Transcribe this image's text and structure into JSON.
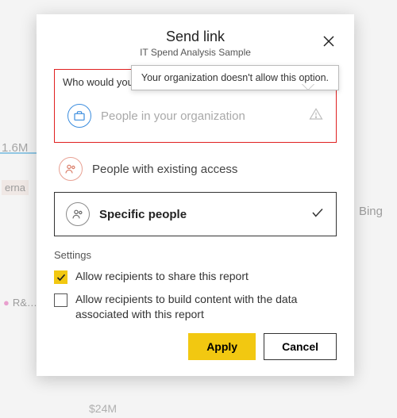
{
  "background": {
    "value": "1.6M",
    "label_erna": "erna",
    "bing": "Bing",
    "rnd": "R&…",
    "bottom": "$24M"
  },
  "dialog": {
    "title": "Send link",
    "subtitle": "IT Spend Analysis Sample",
    "prompt": "Who would you like the lin…",
    "tooltip": "Your organization doesn't allow this option.",
    "options": {
      "org": "People in your organization",
      "existing": "People with existing access",
      "specific": "Specific people"
    },
    "settings": {
      "heading": "Settings",
      "allow_share": "Allow recipients to share this report",
      "allow_build": "Allow recipients to build content with the data associated with this report"
    },
    "buttons": {
      "apply": "Apply",
      "cancel": "Cancel"
    }
  }
}
